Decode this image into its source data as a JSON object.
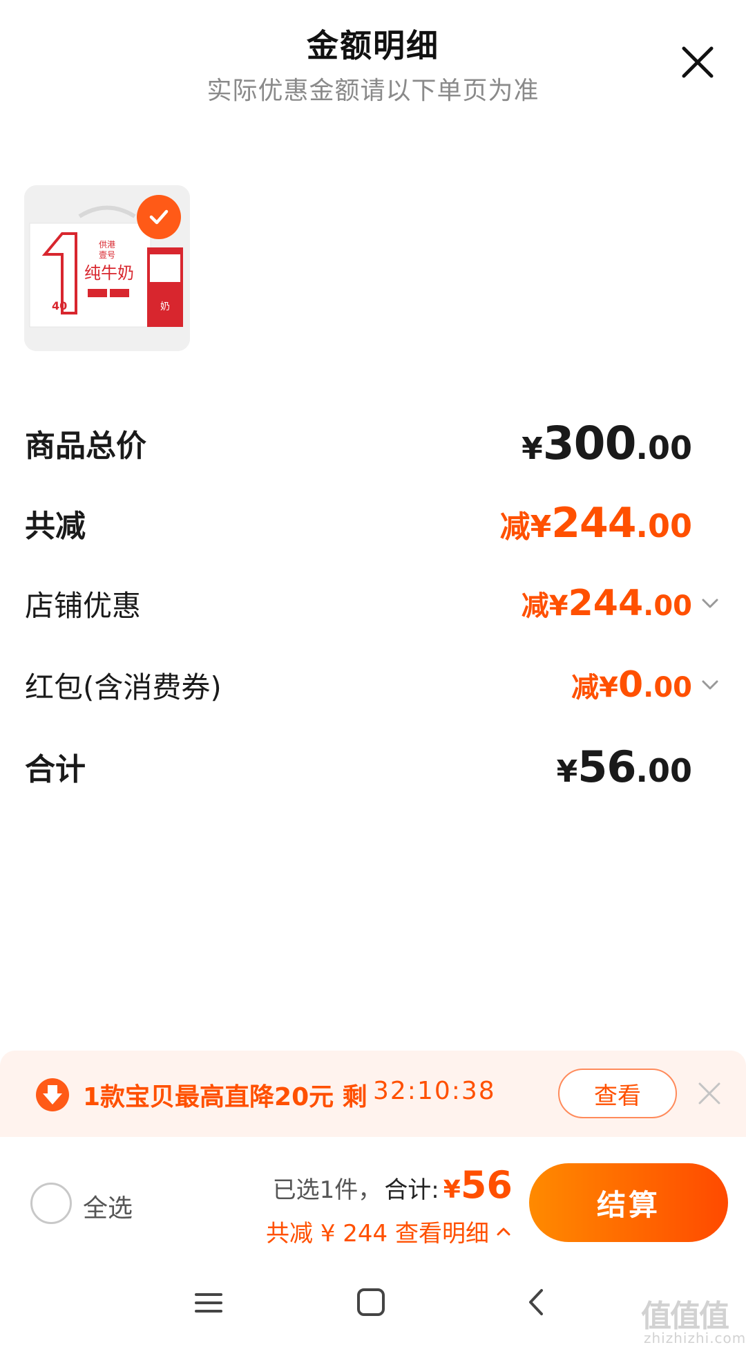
{
  "header": {
    "title": "金额明细",
    "subtitle": "实际优惠金额请以下单页为准",
    "close_icon": "close-icon"
  },
  "product": {
    "brand_line1": "供港",
    "brand_line2": "壹号",
    "name": "纯牛奶",
    "big_number": "1",
    "badge_number": "40",
    "selected": true
  },
  "rows": {
    "total_price": {
      "label": "商品总价",
      "symbol": "¥",
      "integer": "300",
      "decimal": ".00"
    },
    "total_discount": {
      "label": "共减",
      "prefix": "减¥",
      "integer": "244",
      "decimal": ".00"
    },
    "store_discount": {
      "label": "店铺优惠",
      "prefix": "减¥",
      "integer": "244",
      "decimal": ".00"
    },
    "red_packet": {
      "label": "红包(含消费券)",
      "prefix": "减¥",
      "integer": "0",
      "decimal": ".00"
    },
    "sum": {
      "label": "合计",
      "symbol": "¥",
      "integer": "56",
      "decimal": ".00"
    }
  },
  "promo": {
    "text": "1款宝贝最高直降20元 剩",
    "timer": "32:10:38",
    "view_button": "查看"
  },
  "checkout": {
    "select_all": "全选",
    "selected_count": "已选1件，",
    "sum_label": "合计:",
    "sum_symbol": "¥",
    "sum_value": "56",
    "discount_text": "共减 ¥ 244  查看明细",
    "button": "结算"
  },
  "watermark": {
    "mark": "值值值",
    "url": "zhizhizhi.com"
  },
  "colors": {
    "accent": "#ff5000",
    "promo_bg": "#fff3ee",
    "button_gradient_start": "#ff8a00",
    "button_gradient_end": "#ff4a00"
  }
}
